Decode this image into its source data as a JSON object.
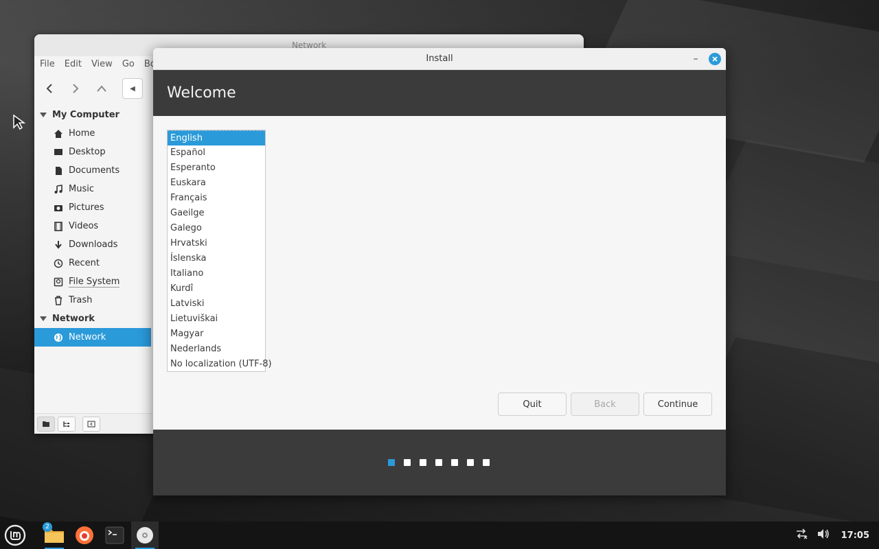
{
  "file_manager": {
    "title": "Network",
    "menu": [
      "File",
      "Edit",
      "View",
      "Go",
      "Bo"
    ],
    "sidebar": {
      "sections": [
        {
          "header": "My Computer",
          "items": [
            {
              "label": "Home",
              "icon": "home-icon"
            },
            {
              "label": "Desktop",
              "icon": "desktop-icon"
            },
            {
              "label": "Documents",
              "icon": "document-icon"
            },
            {
              "label": "Music",
              "icon": "music-icon"
            },
            {
              "label": "Pictures",
              "icon": "camera-icon"
            },
            {
              "label": "Videos",
              "icon": "film-icon"
            },
            {
              "label": "Downloads",
              "icon": "download-icon"
            },
            {
              "label": "Recent",
              "icon": "clock-icon"
            },
            {
              "label": "File System",
              "icon": "drive-icon"
            },
            {
              "label": "Trash",
              "icon": "trash-icon"
            }
          ]
        },
        {
          "header": "Network",
          "items": [
            {
              "label": "Network",
              "icon": "globe-icon",
              "selected": true
            }
          ]
        }
      ]
    }
  },
  "installer": {
    "title": "Install",
    "heading": "Welcome",
    "languages": [
      "English",
      "Español",
      "Esperanto",
      "Euskara",
      "Français",
      "Gaeilge",
      "Galego",
      "Hrvatski",
      "Íslenska",
      "Italiano",
      "Kurdî",
      "Latviski",
      "Lietuviškai",
      "Magyar",
      "Nederlands",
      "No localization (UTF-8)"
    ],
    "selected_language": "English",
    "buttons": {
      "quit": "Quit",
      "back": "Back",
      "continue": "Continue"
    },
    "progress": {
      "total_steps": 7,
      "current_step": 1
    }
  },
  "taskbar": {
    "files_badge": "2",
    "clock": "17:05"
  },
  "colors": {
    "accent": "#2a9ad9",
    "header_dark": "#3b3b3b",
    "taskbar": "#141414"
  }
}
